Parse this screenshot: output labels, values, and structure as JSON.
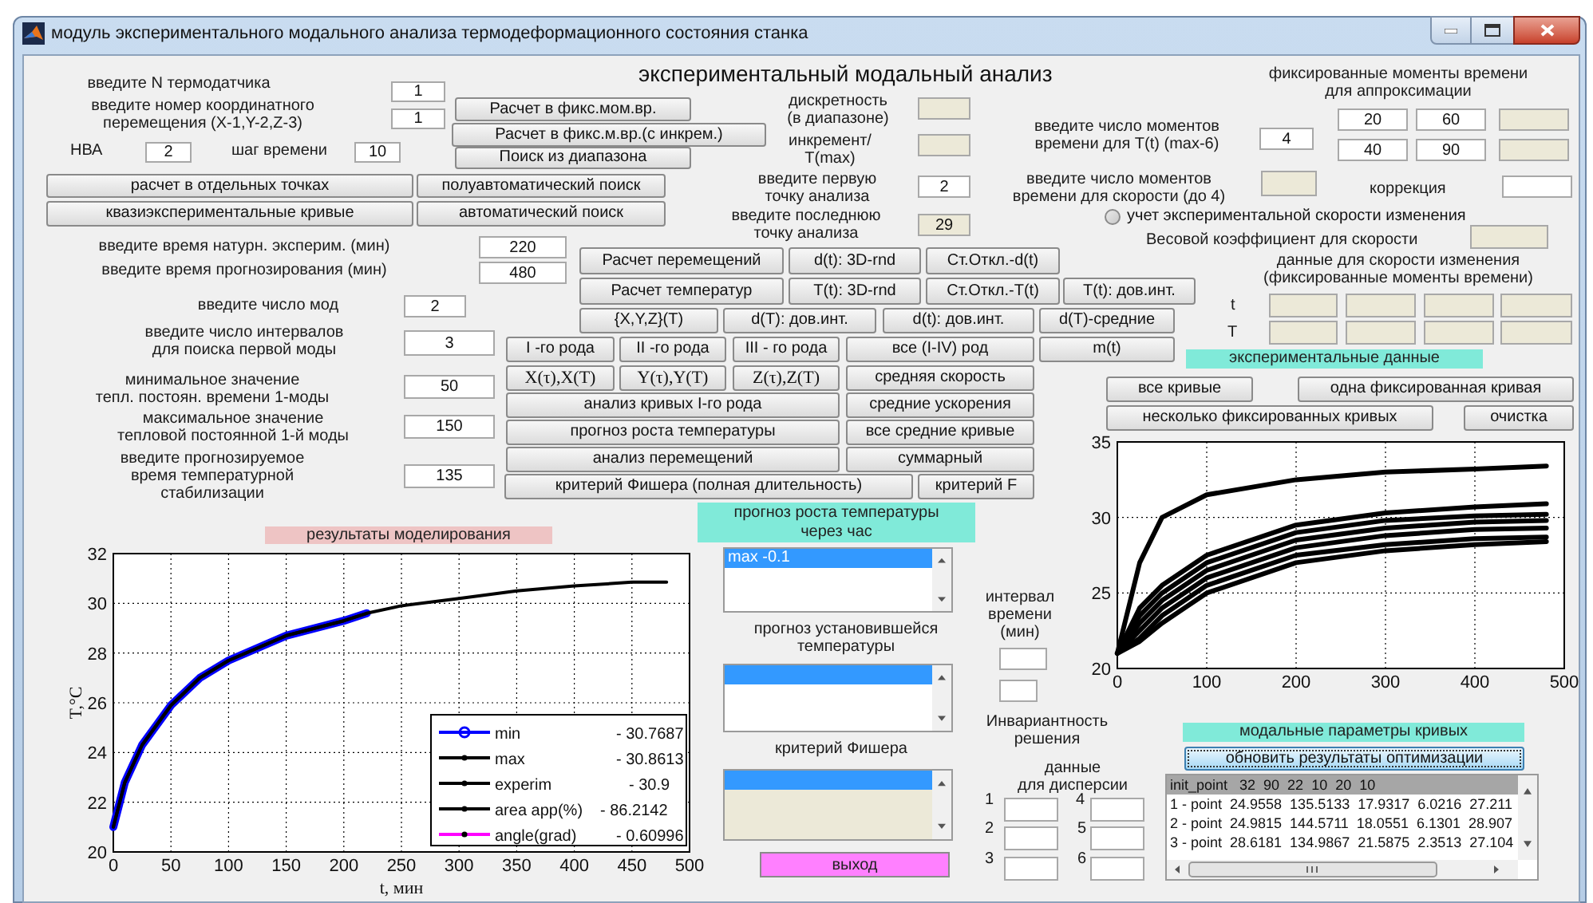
{
  "window": {
    "title": "модуль экспериментального модального анализа термодеформационного состояния станка"
  },
  "heading": "экспериментальный модальный анализ",
  "labels": [
    "введите N термодатчика",
    "введите номер координатного\nперемещения (X-1,Y-2,Z-3)",
    "НВА",
    "шаг времени",
    "введите время натурн. эксперим. (мин)",
    "введите время прогнозирования (мин)",
    "введите число мод",
    "введите число интервалов\nдля поиска первой моды",
    "минимальное значение\nтепл. постоян. времени 1-моды",
    "максимальное значение\nтепловой постоянной 1-й моды",
    "введите прогнозируемое\nвремя температурной\nстабилизации",
    "дискретность\n(в диапазоне)",
    "инкремент/\nT(max)",
    "введите первую\nточку анализа",
    "введите последнюю\nточку анализа",
    "фиксированные моменты времени\nдля аппроксимации",
    "введите число моментов\nвремени для T(t) (max-6)",
    "введите число моментов\nвремени для скорости (до 4)",
    "коррекция",
    "Весовой коэффициент для скорости",
    "данные для скорости изменения\n(фиксированные моменты времени)",
    "t",
    "T",
    "прогноз установившейся\nтемпературы",
    "критерий Фишера",
    "интервал\nвремени\n(мин)",
    "Инвариантность\nрешения",
    "данные\nдля дисперсии",
    "1",
    "2",
    "3",
    "4",
    "5",
    "6"
  ],
  "fields": [
    {
      "value": "1",
      "inactive": false
    },
    {
      "value": "1",
      "inactive": false
    },
    {
      "value": "2",
      "inactive": false
    },
    {
      "value": "10",
      "inactive": false
    },
    {
      "value": "220",
      "inactive": false
    },
    {
      "value": "480",
      "inactive": false
    },
    {
      "value": "2",
      "inactive": false
    },
    {
      "value": "3",
      "inactive": false
    },
    {
      "value": "50",
      "inactive": false
    },
    {
      "value": "150",
      "inactive": false
    },
    {
      "value": "135",
      "inactive": false
    },
    {
      "inactive": true
    },
    {
      "inactive": true
    },
    {
      "value": "2",
      "inactive": false
    },
    {
      "value": "29",
      "inactive": true
    },
    {
      "value": "4",
      "inactive": false
    },
    {
      "value": "20",
      "inactive": false
    },
    {
      "value": "60",
      "inactive": false
    },
    {
      "inactive": true
    },
    {
      "value": "40",
      "inactive": false
    },
    {
      "value": "90",
      "inactive": false
    },
    {
      "inactive": true
    },
    {
      "inactive": true
    },
    {
      "inactive": false
    },
    {
      "inactive": true
    },
    {
      "inactive": true
    },
    {
      "inactive": true
    },
    {
      "inactive": true
    },
    {
      "inactive": true
    },
    {
      "inactive": true
    },
    {
      "inactive": true
    },
    {
      "inactive": true
    },
    {
      "inactive": true
    },
    {
      "inactive": false
    },
    {
      "inactive": false
    },
    {
      "inactive": false
    },
    {
      "inactive": false
    },
    {
      "inactive": false
    },
    {
      "inactive": false
    },
    {
      "inactive": false
    },
    {
      "inactive": false
    }
  ],
  "buttons": [
    "Расчет в фикс.мом.вр.",
    "Расчет в фикс.м.вр.(с инкрем.)",
    "Поиск из диапазона",
    "расчет в отдельных точках",
    "полуавтоматический поиск",
    "квазиэкспериментальные кривые",
    "автоматический поиск",
    "Расчет перемещений",
    "d(t): 3D-rnd",
    "Ст.Откл.-d(t)",
    "Расчет температур",
    "T(t): 3D-rnd",
    "Ст.Откл.-T(t)",
    "T(t): дов.инт.",
    "{X,Y,Z}(T)",
    "d(T): дов.инт.",
    "d(t): дов.инт.",
    "d(T)-средние",
    "I -го рода",
    "II -го рода",
    "III - го рода",
    "все (I-IV) род",
    "m(t)",
    "X(τ),X(T)",
    "Y(τ),Y(T)",
    "Z(τ),Z(T)",
    "средняя скорость",
    "анализ кривых I-го рода",
    "средние ускорения",
    "прогноз роста температуры",
    "все средние кривые",
    "анализ перемещений",
    "суммарный",
    "критерий Фишера (полная длительность)",
    "критерий F",
    "все кривые",
    "одна фиксированная кривая",
    "несколько фиксированных кривых",
    "очистка"
  ],
  "radio": {
    "label": "учет экспериментальной скорости изменения",
    "checked": false
  },
  "section_titles": [
    {
      "text": "результаты моделирования",
      "color": "#eec4c4"
    },
    {
      "text": "прогноз роста температуры\nчерез час",
      "color": "#80ead9"
    },
    {
      "text": "экспериментальные данные",
      "color": "#80ead9"
    },
    {
      "text": "модальные параметры кривых",
      "color": "#80ead9"
    }
  ],
  "lists": [
    {
      "items": [
        {
          "text": "max -0.1",
          "selected": true
        }
      ],
      "highlight_row": false,
      "inactive": false
    },
    {
      "highlight_row": true,
      "inactive": false
    },
    {
      "highlight_row": true,
      "inactive": true
    }
  ],
  "exit_button": {
    "text": "выход",
    "color": "#ff80ff"
  },
  "update_button": {
    "text": "обновить результаты оптимизации",
    "focused": true
  },
  "results_list": {
    "items": [
      {
        "text": "init_point   32  90  22  10  20  10",
        "selected": true
      },
      {
        "text": "1 - point  24.9558  135.5133  17.9317  6.0216  27.211",
        "selected": false
      },
      {
        "text": "2 - point  24.9815  144.5711  18.0551  6.1301  28.907",
        "selected": false
      },
      {
        "text": "3 - point  28.6181  134.9867  21.5875  2.3513  27.104",
        "selected": false
      }
    ]
  },
  "model_chart": {
    "legend_values": [
      "- 30.7687",
      "- 30.8613",
      "- 30.9",
      "- 86.2142",
      "- 0.60996"
    ],
    "chart_data": {
      "type": "line",
      "grid": true,
      "legend": true,
      "xlabel": "t, мин",
      "ylabel": "T,°C",
      "x": [
        0,
        10,
        25,
        50,
        75,
        100,
        150,
        200,
        220,
        250,
        300,
        350,
        400,
        450,
        480
      ],
      "xlim": [
        0,
        500
      ],
      "ylim": [
        20,
        32
      ],
      "xticks": [
        0,
        50,
        100,
        150,
        200,
        250,
        300,
        350,
        400,
        450,
        500
      ],
      "yticks": [
        20,
        22,
        24,
        26,
        28,
        30,
        32
      ],
      "series": [
        {
          "name": "min",
          "color": "#0000ff",
          "values": [
            21.0,
            22.8,
            24.3,
            25.9,
            27.0,
            27.7,
            28.7,
            29.3,
            29.6,
            null,
            null,
            null,
            null,
            null,
            null
          ]
        },
        {
          "name": "max",
          "color": "#000000",
          "values": [
            21.0,
            22.8,
            24.3,
            25.9,
            27.0,
            27.7,
            28.7,
            29.3,
            29.6,
            null,
            null,
            null,
            null,
            null,
            null
          ]
        },
        {
          "name": "experim",
          "color": "#000000",
          "values": [
            21.0,
            22.8,
            24.3,
            25.9,
            27.0,
            27.7,
            28.7,
            29.3,
            29.6,
            29.9,
            30.2,
            30.5,
            30.7,
            30.85,
            30.85
          ]
        },
        {
          "name": "area app(%)",
          "color": "#000000",
          "values": [
            null,
            null,
            null,
            null,
            null,
            null,
            null,
            null,
            null,
            null,
            null,
            null,
            null,
            null,
            null
          ]
        },
        {
          "name": "angle(grad)",
          "color": "#ff00ff",
          "values": [
            null,
            null,
            null,
            null,
            null,
            null,
            null,
            null,
            null,
            null,
            null,
            null,
            null,
            null,
            null
          ]
        }
      ]
    }
  },
  "experiment_chart": {
    "chart_data": {
      "type": "line",
      "grid": true,
      "x": [
        0,
        25,
        50,
        100,
        200,
        300,
        400,
        480
      ],
      "xlim": [
        0,
        500
      ],
      "ylim": [
        20,
        35
      ],
      "xticks": [
        0,
        100,
        200,
        300,
        400,
        500
      ],
      "yticks": [
        20,
        25,
        30,
        35
      ],
      "series": [
        {
          "color": "#000000",
          "values": [
            21,
            27,
            30,
            31.5,
            32.5,
            33,
            33.2,
            33.4
          ]
        },
        {
          "color": "#000000",
          "values": [
            21,
            24,
            25.5,
            27.5,
            29.5,
            30.3,
            30.7,
            30.9
          ]
        },
        {
          "color": "#000000",
          "values": [
            21,
            23.5,
            25,
            27,
            29,
            29.8,
            30.1,
            30.2
          ]
        },
        {
          "color": "#000000",
          "values": [
            21,
            23,
            24.5,
            26.5,
            28.5,
            29.3,
            29.7,
            29.8
          ]
        },
        {
          "color": "#000000",
          "values": [
            21,
            22.5,
            24,
            26,
            28,
            28.8,
            29.2,
            29.3
          ]
        },
        {
          "color": "#000000",
          "values": [
            21,
            22,
            23.5,
            25.5,
            27.5,
            28.2,
            28.6,
            28.7
          ]
        },
        {
          "color": "#000000",
          "values": [
            21,
            21.8,
            23,
            25,
            27,
            27.8,
            28.2,
            28.4
          ]
        }
      ]
    }
  }
}
